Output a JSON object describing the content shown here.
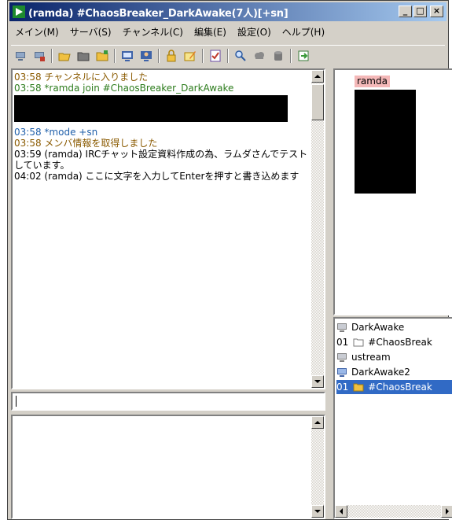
{
  "window": {
    "title": "(ramda) #ChaosBreaker_DarkAwake(7人)[+sn]",
    "controls": [
      "_",
      "□",
      "×"
    ]
  },
  "menu": {
    "items": [
      "メイン(M)",
      "サーバ(S)",
      "チャンネル(C)",
      "編集(E)",
      "設定(O)",
      "ヘルプ(H)"
    ]
  },
  "toolbar": {
    "icons": [
      "server-icon",
      "server-disconnect-icon",
      "folder-open-icon",
      "folder-icon",
      "folder-add-icon",
      "monitor-icon",
      "person-monitor-icon",
      "lock-icon",
      "edit-icon",
      "checklist-icon",
      "magnifier-icon",
      "cloud-icon",
      "database-icon",
      "export-icon"
    ]
  },
  "log": {
    "lines": [
      {
        "time": "03:58",
        "text": "チャンネルに入りました",
        "color": "#8a5a00"
      },
      {
        "time": "03:58",
        "text": "*ramda join #ChaosBreaker_DarkAwake",
        "color": "#2e7d1e"
      },
      {
        "time": "03:58",
        "text": "*mode +sn",
        "color": "#1f5faa"
      },
      {
        "time": "03:58",
        "text": "メンバ情報を取得しました",
        "color": "#8a5a00"
      },
      {
        "time": "03:59",
        "text": "(ramda) IRCチャット設定資料作成の為、ラムダさんでテストしています。",
        "color": "#000000"
      },
      {
        "time": "04:02",
        "text": "(ramda) ここに文字を入力してEnterを押すと書き込めます",
        "color": "#000000"
      }
    ]
  },
  "users": {
    "nick": "ramda",
    "nick_bg": "#f4b8b8"
  },
  "tree": {
    "rows": [
      {
        "prefix": "",
        "label": "DarkAwake",
        "icon": "server-icon",
        "selected": false
      },
      {
        "prefix": "01",
        "label": "#ChaosBreak",
        "icon": "folder-icon",
        "selected": false
      },
      {
        "prefix": "",
        "label": "ustream",
        "icon": "server-icon",
        "selected": false
      },
      {
        "prefix": "",
        "label": "DarkAwake2",
        "icon": "server-icon",
        "selected": false
      },
      {
        "prefix": "01",
        "label": "#ChaosBreak",
        "icon": "folder-icon",
        "selected": true
      }
    ]
  },
  "colors": {
    "titlebar_start": "#0a246a",
    "titlebar_end": "#a6caf0",
    "selection": "#316ac5",
    "face": "#d4d0c8"
  }
}
